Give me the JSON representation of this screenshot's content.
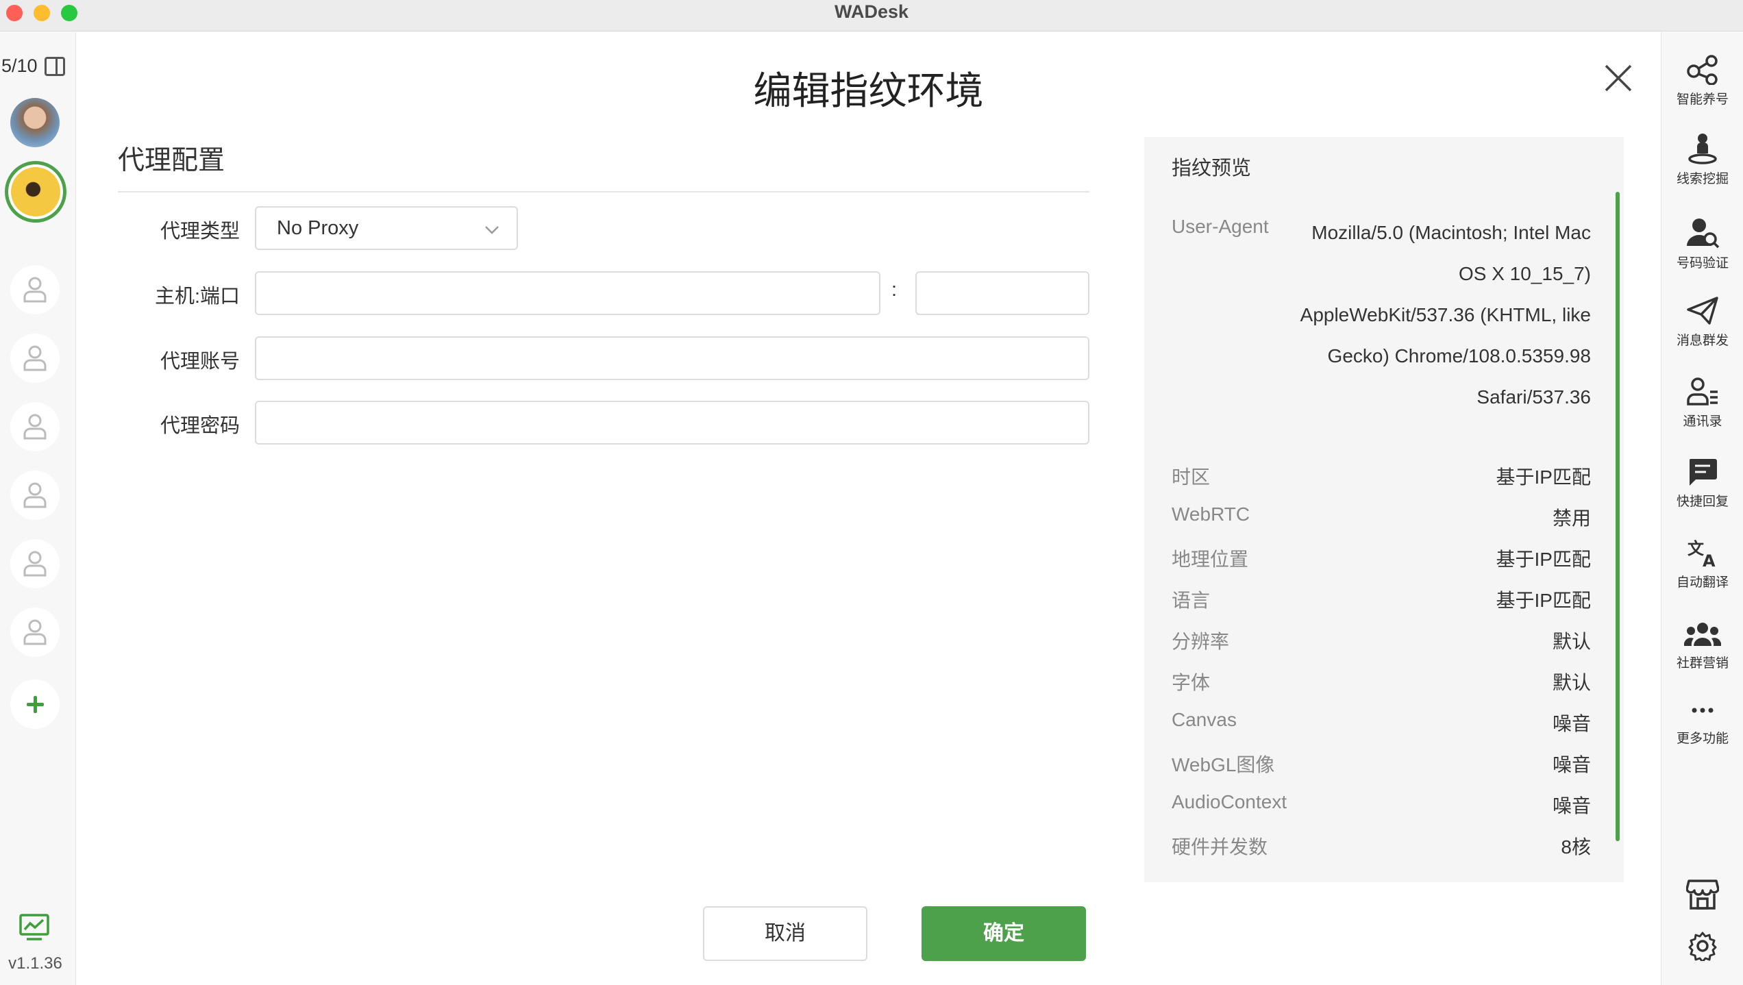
{
  "window": {
    "title": "WADesk"
  },
  "left_sidebar": {
    "account_count": "5/10",
    "version": "v1.1.36"
  },
  "right_sidebar": {
    "items": [
      {
        "label": "智能养号",
        "icon": "share-nodes-icon"
      },
      {
        "label": "线索挖掘",
        "icon": "person-pin-icon"
      },
      {
        "label": "号码验证",
        "icon": "user-search-icon"
      },
      {
        "label": "消息群发",
        "icon": "paper-plane-icon"
      },
      {
        "label": "通讯录",
        "icon": "contacts-icon"
      },
      {
        "label": "快捷回复",
        "icon": "chat-bubble-icon"
      },
      {
        "label": "自动翻译",
        "icon": "translate-icon"
      },
      {
        "label": "社群营销",
        "icon": "group-icon"
      },
      {
        "label": "更多功能",
        "icon": "more-dots-icon"
      }
    ]
  },
  "dialog": {
    "title": "编辑指纹环境",
    "section_title": "代理配置",
    "fields": {
      "proxy_type_label": "代理类型",
      "proxy_type_value": "No Proxy",
      "host_port_label": "主机:端口",
      "host_value": "",
      "port_value": "",
      "separator": ":",
      "proxy_account_label": "代理账号",
      "proxy_account_value": "",
      "proxy_password_label": "代理密码",
      "proxy_password_value": ""
    },
    "buttons": {
      "cancel": "取消",
      "confirm": "确定"
    }
  },
  "preview": {
    "title": "指纹预览",
    "user_agent_label": "User-Agent",
    "user_agent_value": "Mozilla/5.0 (Macintosh; Intel Mac OS X 10_15_7) AppleWebKit/537.36 (KHTML, like Gecko) Chrome/108.0.5359.98 Safari/537.36",
    "rows": [
      {
        "key": "时区",
        "value": "基于IP匹配"
      },
      {
        "key": "WebRTC",
        "value": "禁用"
      },
      {
        "key": "地理位置",
        "value": "基于IP匹配"
      },
      {
        "key": "语言",
        "value": "基于IP匹配"
      },
      {
        "key": "分辨率",
        "value": "默认"
      },
      {
        "key": "字体",
        "value": "默认"
      },
      {
        "key": "Canvas",
        "value": "噪音"
      },
      {
        "key": "WebGL图像",
        "value": "噪音"
      },
      {
        "key": "AudioContext",
        "value": "噪音"
      },
      {
        "key": "硬件并发数",
        "value": "8核"
      }
    ]
  },
  "colors": {
    "accent": "#4ca14a"
  }
}
